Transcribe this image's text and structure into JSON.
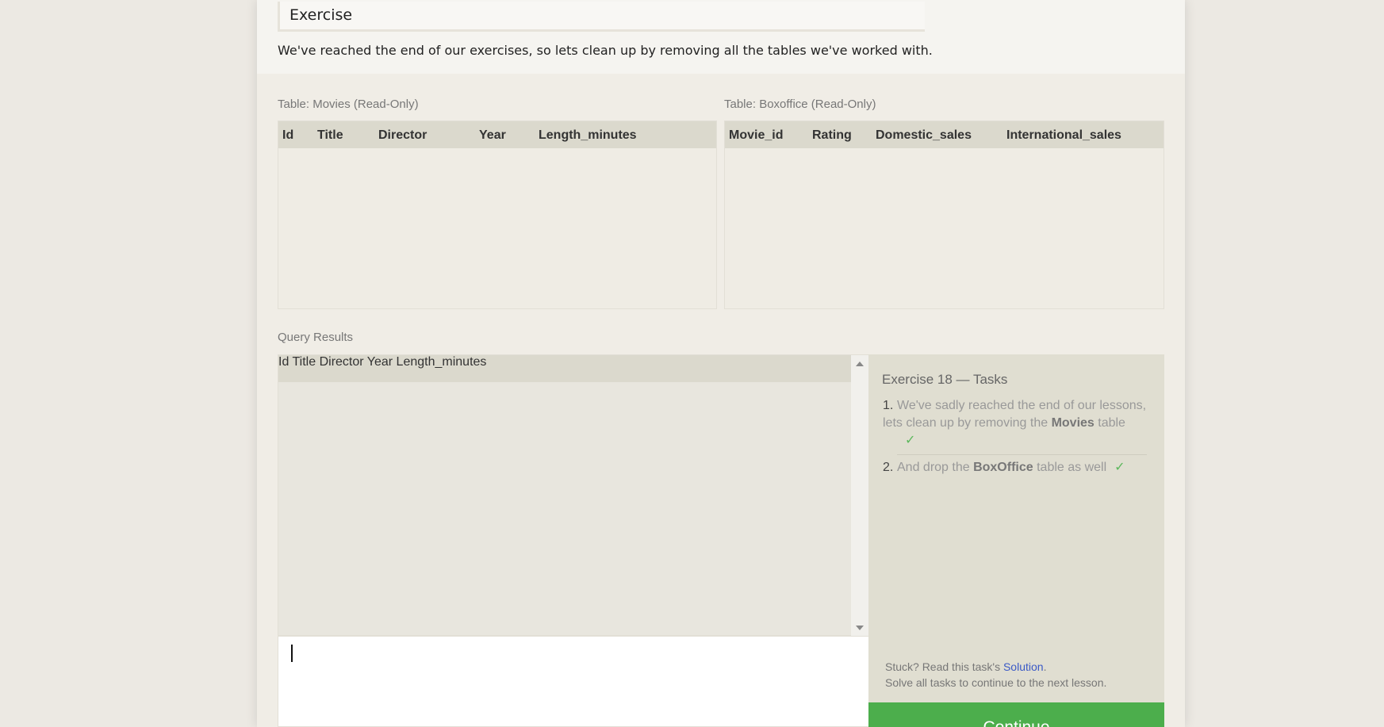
{
  "exercise": {
    "title": "Exercise",
    "description": "We've reached the end of our exercises, so lets clean up by removing all the tables we've worked with."
  },
  "movies_table": {
    "label": "Table: Movies (Read-Only)",
    "columns": [
      "Id",
      "Title",
      "Director",
      "Year",
      "Length_minutes"
    ]
  },
  "boxoffice_table": {
    "label": "Table: Boxoffice (Read-Only)",
    "columns": [
      "Movie_id",
      "Rating",
      "Domestic_sales",
      "International_sales"
    ]
  },
  "results": {
    "label": "Query Results",
    "columns": [
      "Id",
      "Title",
      "Director",
      "Year",
      "Length_minutes"
    ]
  },
  "tasks": {
    "title": "Exercise 18 — Tasks",
    "items": [
      {
        "num": "1.",
        "pre": "We've sadly reached the end of our lessons, lets clean up by removing the ",
        "bold": "Movies",
        "post": " table",
        "check": "✓"
      },
      {
        "num": "2.",
        "pre": "And drop the ",
        "bold": "BoxOffice",
        "post": " table as well",
        "check": "✓"
      }
    ],
    "stuck_text": "Stuck? Read this task's ",
    "solution_link": "Solution",
    "stuck_period": ".",
    "solve_all": "Solve all tasks to continue to the next lesson."
  },
  "continue_button": {
    "label": "Continue"
  }
}
